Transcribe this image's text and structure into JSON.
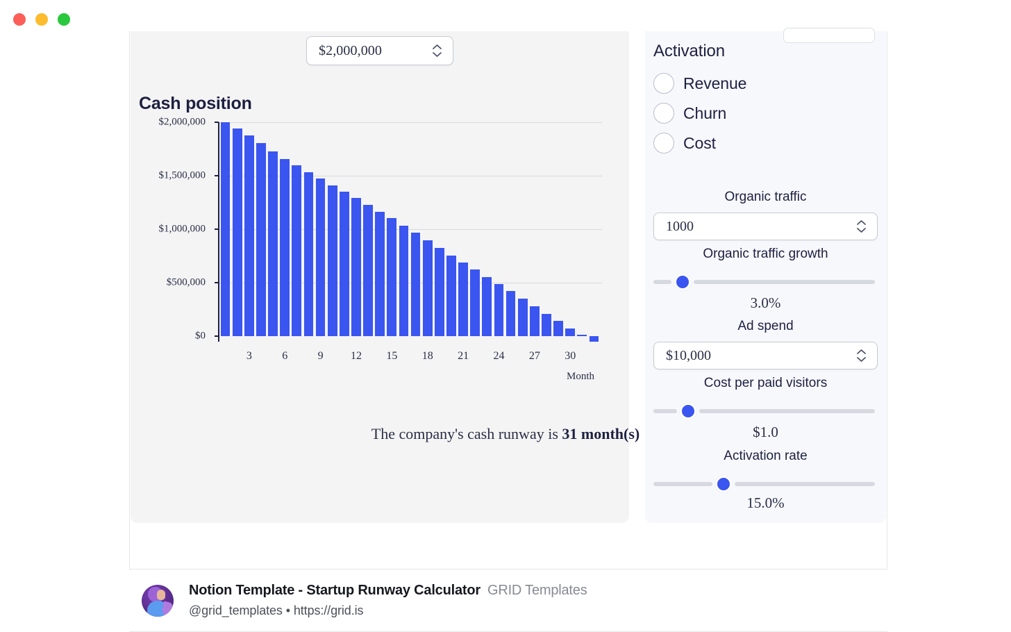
{
  "window": {
    "traffic_lights": [
      "close",
      "minimize",
      "maximize"
    ],
    "colors": {
      "close": "#FB5F57",
      "minimize": "#FCBC2E",
      "maximize": "#2AC83F"
    }
  },
  "chart_panel": {
    "starting_cash_input": {
      "value": "$2,000,000",
      "label": "starting-cash"
    },
    "title": "Cash position",
    "runway_prefix": "The company's cash runway is ",
    "runway_value": "31 month(s)"
  },
  "controls": {
    "section_title": "Activation",
    "radios": [
      {
        "label": "Revenue",
        "selected": false
      },
      {
        "label": "Churn",
        "selected": false
      },
      {
        "label": "Cost",
        "selected": false
      }
    ],
    "fields": [
      {
        "label": "Organic traffic",
        "type": "number",
        "value": "1000"
      },
      {
        "label": "Organic traffic growth",
        "type": "slider",
        "value": "3.0%",
        "percent": 10
      },
      {
        "label": "Ad spend",
        "type": "number",
        "value": "$10,000"
      },
      {
        "label": "Cost per paid visitors",
        "type": "slider",
        "value": "$1.0",
        "percent": 13
      },
      {
        "label": "Activation rate",
        "type": "slider",
        "value": "15.0%",
        "percent": 30
      }
    ],
    "accent_color": "#3A55F0"
  },
  "footer": {
    "title": "Notion Template - Startup Runway Calculator",
    "source": "GRID Templates",
    "handle": "@grid_templates",
    "separator": "•",
    "url": "https://grid.is"
  },
  "chart_data": {
    "type": "bar",
    "title": "Cash position",
    "xlabel": "Month",
    "ylabel": "",
    "ylim": [
      -100000,
      2000000
    ],
    "grid": true,
    "legend": null,
    "bar_color": "#3A55F0",
    "ytick_labels": [
      "$2,000,000",
      "$1,500,000",
      "$1,000,000",
      "$500,000",
      "$0"
    ],
    "ytick_values": [
      2000000,
      1500000,
      1000000,
      500000,
      0
    ],
    "xtick_labels": [
      "3",
      "6",
      "9",
      "12",
      "15",
      "18",
      "21",
      "24",
      "27",
      "30"
    ],
    "xtick_values": [
      3,
      6,
      9,
      12,
      15,
      18,
      21,
      24,
      27,
      30
    ],
    "x": [
      1,
      2,
      3,
      4,
      5,
      6,
      7,
      8,
      9,
      10,
      11,
      12,
      13,
      14,
      15,
      16,
      17,
      18,
      19,
      20,
      21,
      22,
      23,
      24,
      25,
      26,
      27,
      28,
      29,
      30,
      31,
      32
    ],
    "values": [
      2000000,
      1940000,
      1875000,
      1805000,
      1730000,
      1655000,
      1595000,
      1535000,
      1475000,
      1410000,
      1350000,
      1290000,
      1230000,
      1165000,
      1105000,
      1035000,
      965000,
      895000,
      825000,
      755000,
      690000,
      625000,
      555000,
      490000,
      420000,
      350000,
      280000,
      210000,
      140000,
      70000,
      10000,
      -55000
    ],
    "annotation": "The company's cash runway is 31 month(s)"
  }
}
